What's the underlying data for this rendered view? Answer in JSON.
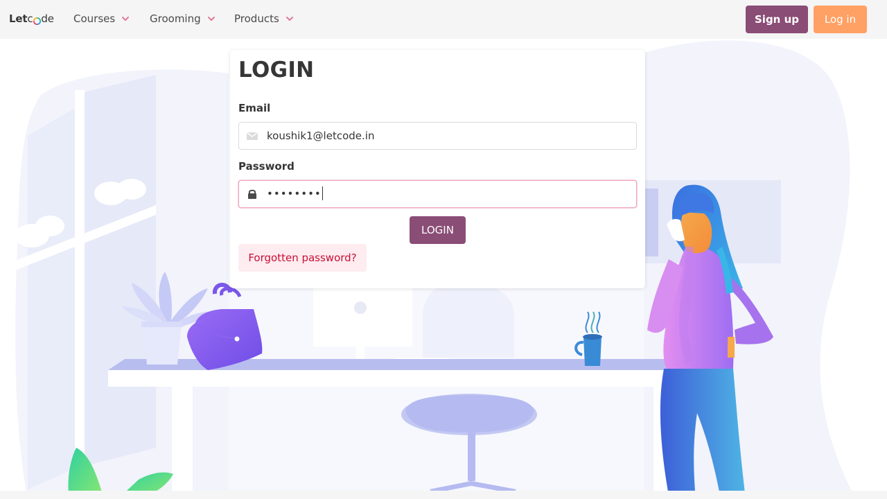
{
  "navbar": {
    "brand": {
      "let": "Let",
      "c": "c",
      "o": "o",
      "de": "de"
    },
    "items": [
      {
        "label": "Courses"
      },
      {
        "label": "Grooming"
      },
      {
        "label": "Products"
      }
    ],
    "signup_label": "Sign up",
    "login_label": "Log in"
  },
  "login_form": {
    "title": "LOGIN",
    "email_label": "Email",
    "email_value": "koushik1@letcode.in",
    "password_label": "Password",
    "password_masked": "••••••••",
    "submit_label": "LOGIN",
    "forgot_label": "Forgotten password?"
  },
  "colors": {
    "primary": "#8a4d76",
    "accent": "#ffa064",
    "danger_light_bg": "#feecf0",
    "danger_text": "#cc0f35",
    "navbar_bg": "#f5f5f5"
  },
  "icons": {
    "email": "envelope-icon",
    "password": "lock-icon",
    "nav_dropdown": "chevron-down-icon"
  }
}
